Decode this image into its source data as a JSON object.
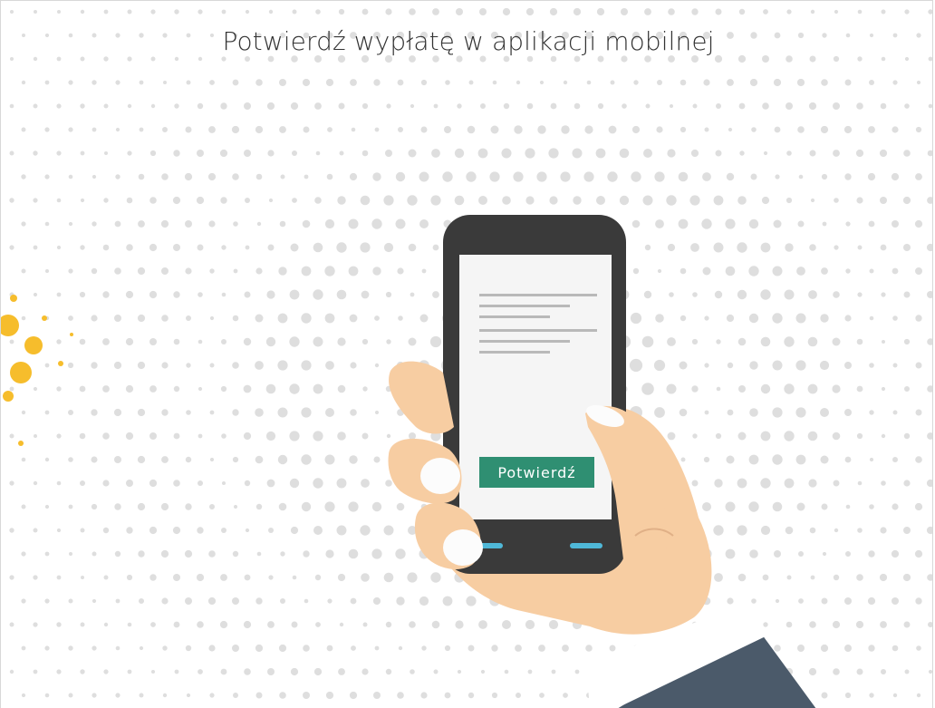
{
  "header": {
    "title": "Potwierdź wypłatę w aplikacji mobilnej"
  },
  "phone": {
    "confirm_button_label": "Potwierdź"
  },
  "colors": {
    "accent_green": "#2f8f72",
    "dot_gray": "#dedede",
    "dot_yellow": "#f6bd2c",
    "phone_body": "#3a3a3a",
    "skin": "#f7cda2",
    "sleeve": "#4b5a6a",
    "nav_blue": "#4fb8d8"
  },
  "icons": [
    "phone-illustration-icon",
    "hand-illustration-icon",
    "dots-pattern-icon"
  ]
}
